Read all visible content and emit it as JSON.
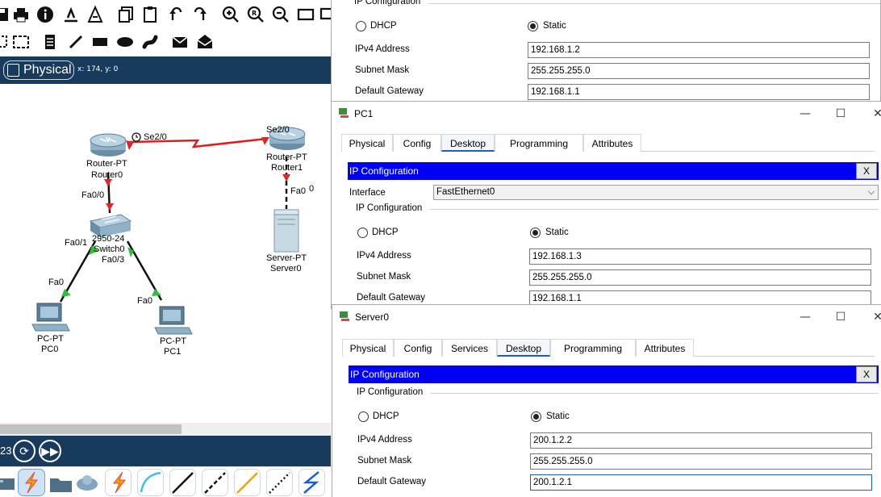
{
  "canvas": {
    "mode_tab": "Physical",
    "coordinates": "x: 174, y: 0",
    "sim_time": "23",
    "devices": [
      {
        "line1": "Router-PT",
        "line2": "Router0"
      },
      {
        "line1": "Router-PT",
        "line2": "Router1"
      },
      {
        "line1": "2950-24",
        "line2": "Switch0"
      },
      {
        "line1": "Server-PT",
        "line2": "Server0"
      },
      {
        "line1": "PC-PT",
        "line2": "PC0"
      },
      {
        "line1": "PC-PT",
        "line2": "PC1"
      }
    ],
    "ports": {
      "r0_se": "Se2/0",
      "r1_se": "Se2/0",
      "r0_fa": "Fa0/0",
      "r1_fa": "Fa0",
      "r1_fa_extra": "0",
      "sw_fa01": "Fa0/1",
      "sw_fa03": "Fa0/3",
      "pc0_fa": "Fa0",
      "pc1_fa": "Fa0"
    }
  },
  "window_top": {
    "group_label": "IP Configuration",
    "dhcp": "DHCP",
    "static": "Static",
    "ipv4_label": "IPv4 Address",
    "ipv4": "192.168.1.2",
    "mask_label": "Subnet Mask",
    "mask": "255.255.255.0",
    "gw_label": "Default Gateway",
    "gw": "192.168.1.1"
  },
  "window_pc1": {
    "title": "PC1",
    "tabs": [
      "Physical",
      "Config",
      "Desktop",
      "Programming",
      "Attributes"
    ],
    "active_tab": "Desktop",
    "ip_bar": "IP Configuration",
    "close_x": "X",
    "interface_label": "Interface",
    "interface_value": "FastEthernet0",
    "group_label": "IP Configuration",
    "dhcp": "DHCP",
    "static": "Static",
    "ipv4_label": "IPv4 Address",
    "ipv4": "192.168.1.3",
    "mask_label": "Subnet Mask",
    "mask": "255.255.255.0",
    "gw_label": "Default Gateway",
    "gw": "192.168.1.1"
  },
  "window_server0": {
    "title": "Server0",
    "tabs": [
      "Physical",
      "Config",
      "Services",
      "Desktop",
      "Programming",
      "Attributes"
    ],
    "active_tab": "Desktop",
    "ip_bar": "IP Configuration",
    "close_x": "X",
    "group_label": "IP Configuration",
    "dhcp": "DHCP",
    "static": "Static",
    "ipv4_label": "IPv4 Address",
    "ipv4": "200.1.2.2",
    "mask_label": "Subnet Mask",
    "mask": "255.255.255.0",
    "gw_label": "Default Gateway",
    "gw": "200.1.2.1"
  },
  "colors": {
    "accent_bar": "#0000f5",
    "nav_dark": "#183a5c",
    "serial_link": "#e01b1b",
    "port_down": "#d42a2a",
    "port_up": "#2fbf3a"
  }
}
